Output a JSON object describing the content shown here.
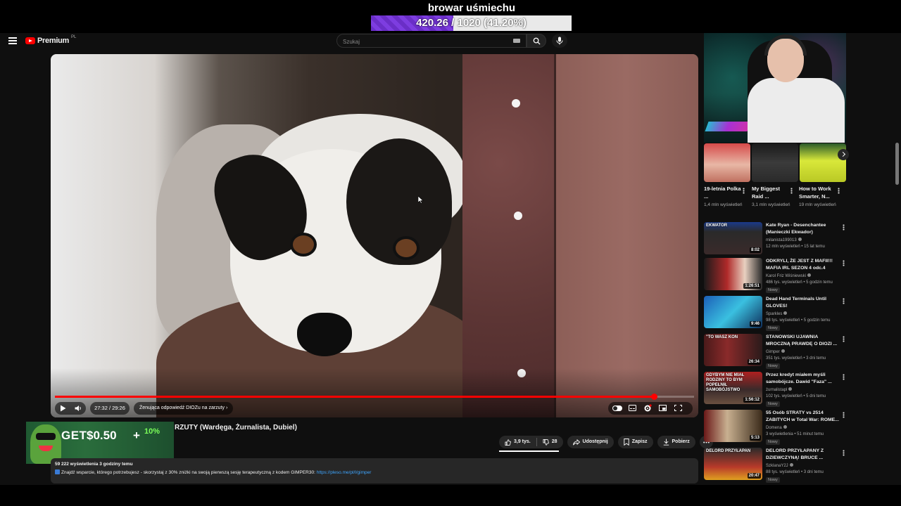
{
  "overlay": {
    "title": "browar uśmiechu",
    "progress_text": "420.26 / 1020 (41.20%)",
    "progress_fraction": 0.412
  },
  "header": {
    "brand": "Premium",
    "brand_sup": "PL",
    "search_placeholder": "Szukaj"
  },
  "player": {
    "time": "27:32 / 29:26",
    "chapter": "Żenująca odpowiedź DIOZu na zarzuty",
    "progress_fraction": 0.937
  },
  "video": {
    "title_visible": "RZUTY (Wardęga, Żurnalista, Dubiel)",
    "likes": "3,9 tys.",
    "dislikes": "28",
    "share": "Udostępnij",
    "save": "Zapisz",
    "download": "Pobierz",
    "views_meta": "59 222 wyświetlenia  3 godziny temu",
    "description": "Znajdź wsparcie, którego potrzebujesz - skorzystaj z 30% zniżki na swoją pierwszą sesję terapeutyczną z kodem GIMPER30: ",
    "description_link": "https://pleso.me/pl/l/gimper"
  },
  "ad": {
    "get": "GET",
    "amount": "$0.50",
    "plus": "+",
    "percent": "10%"
  },
  "shorts": [
    {
      "title": "19-letnia Polka ...",
      "views": "1,4 mln wyświetleń"
    },
    {
      "title": "My Biggest Raid ...",
      "views": "3,1 mln wyświetleń"
    },
    {
      "title": "How to Work Smarter, N...",
      "views": "19 mln wyświetleń"
    }
  ],
  "recommendations": [
    {
      "title": "Kate Ryan - Desenchantee (Manieczki Ekwador)",
      "channel": "milanista199013",
      "meta": "12 mln wyświetleń • 15 lat temu",
      "duration": "8:02",
      "badge": "",
      "thumb_label": "EKWATOR"
    },
    {
      "title": "ODKRYLI, ŻE JEST Z MAFII!!! MAFIA IRL SEZON 4 odc.4",
      "channel": "Karol Friz Wiśniewski",
      "meta": "486 tys. wyświetleń • 5 godzin temu",
      "duration": "1:26:51",
      "badge": "Nowy",
      "thumb_label": ""
    },
    {
      "title": "Dead Hand Terminals Until GLOVES!",
      "channel": "Sparkles",
      "meta": "98 tys. wyświetleń • 5 godzin temu",
      "duration": "9:46",
      "badge": "Nowy",
      "thumb_label": ""
    },
    {
      "title": "STANOWSKI UJAWNIA MROCZNĄ PRAWDĘ O DIOZI ...",
      "channel": "Gimper",
      "meta": "351 tys. wyświetleń • 3 dni temu",
      "duration": "26:34",
      "badge": "Nowy",
      "thumb_label": "\"TO WASZ KON"
    },
    {
      "title": "Przez kredyt miałem myśli samobójcze. Dawid \"Faza\" ...",
      "channel": "żurnalistapl",
      "meta": "102 tys. wyświetleń • 5 dni temu",
      "duration": "1:56:12",
      "badge": "Nowy",
      "thumb_label": "GDYBYM NIE MIAŁ RODZINY TO BYM POPEŁNIŁ SAMOBÓJSTWO"
    },
    {
      "title": "55 Osób STRATY vs 2514 ZABITYCH w Total War: ROME...",
      "channel": "Domena",
      "meta": "3 wyświetlenia • 51 minut temu",
      "duration": "5:13",
      "badge": "Nowy",
      "thumb_label": ""
    },
    {
      "title": "DELORD PRZYŁAPANY Z DZIEWCZYNĄ! BRUCE ...",
      "channel": "SzklanaY2J",
      "meta": "88 tys. wyświetleń • 3 dni temu",
      "duration": "20:47",
      "badge": "Nowy",
      "thumb_label": "DELORD PRZYŁAPAN"
    }
  ],
  "colors": {
    "accent": "#ff0000",
    "overlay_fill": "#7d3de0",
    "background": "#0f0f0f",
    "link": "#3ea6ff"
  }
}
